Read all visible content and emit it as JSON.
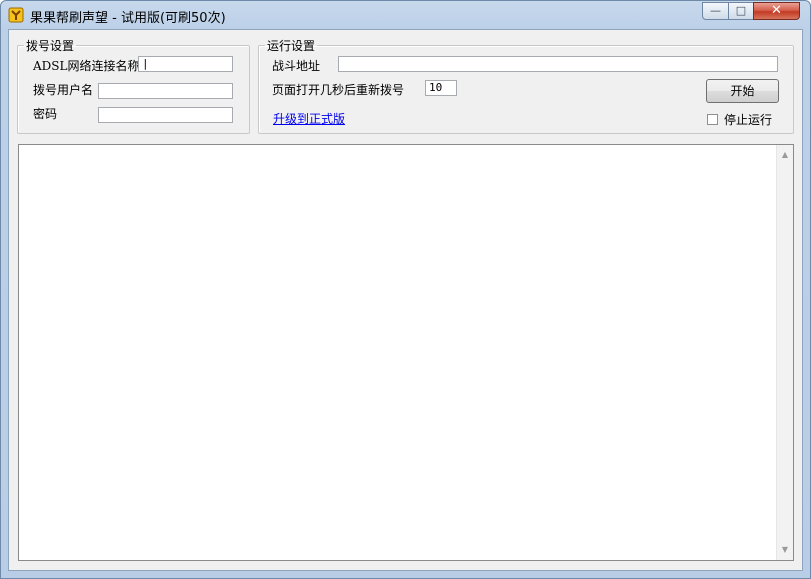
{
  "window": {
    "title": "果果帮刷声望 - 试用版(可刷50次)",
    "controls": {
      "minimize": "—",
      "maximize": "□",
      "close": "✕"
    }
  },
  "dial_settings": {
    "legend": "拨号设置",
    "adsl_label": "ADSL网络连接名称",
    "adsl_value": "|",
    "user_label": "拨号用户名",
    "user_value": "",
    "password_label": "密码",
    "password_value": ""
  },
  "run_settings": {
    "legend": "运行设置",
    "url_label": "战斗地址",
    "url_value": "",
    "seconds_label": "页面打开几秒后重新拨号",
    "seconds_value": "10",
    "upgrade_link": "升级到正式版",
    "start_button": "开始",
    "stop_label": "停止运行",
    "stop_checked": false
  },
  "log": {
    "content": "",
    "scroll_up": "▲",
    "scroll_down": "▼"
  },
  "icons": {
    "app": "app-logo-icon"
  }
}
